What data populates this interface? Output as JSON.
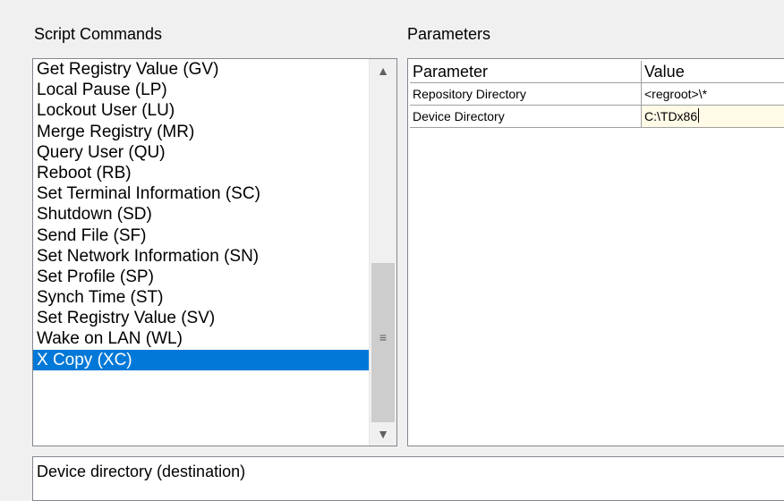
{
  "labels": {
    "script_commands": "Script Commands",
    "parameters": "Parameters"
  },
  "commands": [
    {
      "label": "Get Registry Value (GV)"
    },
    {
      "label": "Local Pause (LP)"
    },
    {
      "label": "Lockout User (LU)"
    },
    {
      "label": "Merge Registry (MR)"
    },
    {
      "label": "Query User (QU)"
    },
    {
      "label": "Reboot (RB)"
    },
    {
      "label": "Set Terminal Information (SC)"
    },
    {
      "label": "Shutdown (SD)"
    },
    {
      "label": "Send File (SF)"
    },
    {
      "label": "Set Network Information (SN)"
    },
    {
      "label": "Set Profile (SP)"
    },
    {
      "label": "Synch Time (ST)"
    },
    {
      "label": "Set Registry Value (SV)"
    },
    {
      "label": "Wake on LAN (WL)"
    },
    {
      "label": "X Copy (XC)"
    }
  ],
  "selected_command": "X Copy (XC)",
  "scrollbar": {
    "up_icon": "▲",
    "down_icon": "▼",
    "grip_icon": "≡"
  },
  "param_grid": {
    "headers": {
      "parameter": "Parameter",
      "value": "Value"
    },
    "rows": [
      {
        "parameter": "Repository Directory",
        "value": "<regroot>\\*"
      },
      {
        "parameter": "Device  Directory",
        "value": "C:\\TDx86"
      }
    ]
  },
  "description": "Device directory (destination)",
  "colors": {
    "selection": "#0078d7",
    "edit_cell": "#fffbe6"
  }
}
